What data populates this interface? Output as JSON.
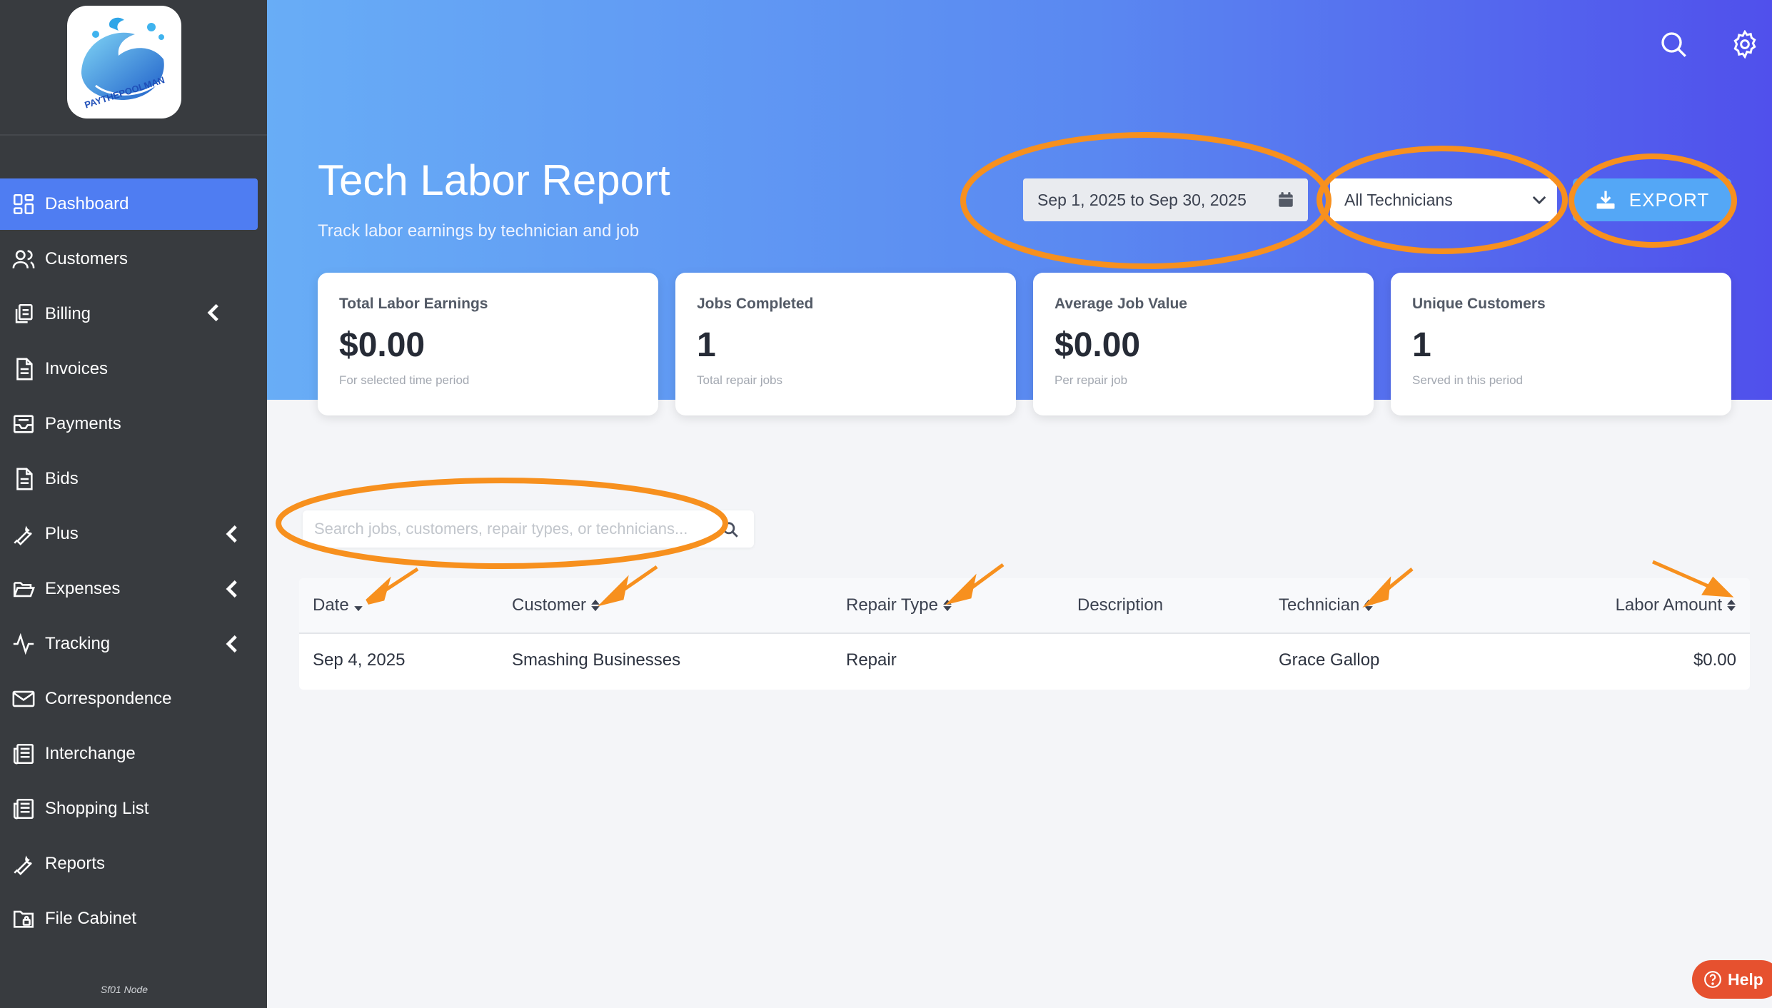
{
  "sidebar": {
    "logo_text": "PAYTHEPOOLMAN",
    "items": [
      {
        "label": "Dashboard",
        "icon": "dashboard-grid-icon",
        "active": true,
        "has_submenu": false
      },
      {
        "label": "Customers",
        "icon": "users-icon",
        "active": false,
        "has_submenu": false
      },
      {
        "label": "Billing",
        "icon": "billing-stack-icon",
        "active": false,
        "has_submenu": true
      },
      {
        "label": "Invoices",
        "icon": "document-icon",
        "active": false,
        "has_submenu": false
      },
      {
        "label": "Payments",
        "icon": "inbox-icon",
        "active": false,
        "has_submenu": false
      },
      {
        "label": "Bids",
        "icon": "document-icon",
        "active": false,
        "has_submenu": false
      },
      {
        "label": "Plus",
        "icon": "wrench-icon",
        "active": false,
        "has_submenu": true
      },
      {
        "label": "Expenses",
        "icon": "folder-open-icon",
        "active": false,
        "has_submenu": true
      },
      {
        "label": "Tracking",
        "icon": "activity-icon",
        "active": false,
        "has_submenu": true
      },
      {
        "label": "Correspondence",
        "icon": "mail-icon",
        "active": false,
        "has_submenu": false
      },
      {
        "label": "Interchange",
        "icon": "newspaper-icon",
        "active": false,
        "has_submenu": false
      },
      {
        "label": "Shopping List",
        "icon": "newspaper-icon",
        "active": false,
        "has_submenu": false
      },
      {
        "label": "Reports",
        "icon": "wrench-icon",
        "active": false,
        "has_submenu": false
      },
      {
        "label": "File Cabinet",
        "icon": "folder-lock-icon",
        "active": false,
        "has_submenu": false
      }
    ],
    "footer": "Sf01 Node"
  },
  "header": {
    "title": "Tech Labor Report",
    "subtitle": "Track labor earnings by technician and job",
    "date_range": "Sep 1, 2025 to Sep 30, 2025",
    "technician_filter": "All Technicians",
    "export_label": "EXPORT"
  },
  "cards": [
    {
      "label": "Total Labor Earnings",
      "value": "$0.00",
      "note": "For selected time period"
    },
    {
      "label": "Jobs Completed",
      "value": "1",
      "note": "Total repair jobs"
    },
    {
      "label": "Average Job Value",
      "value": "$0.00",
      "note": "Per repair job"
    },
    {
      "label": "Unique Customers",
      "value": "1",
      "note": "Served in this period"
    }
  ],
  "search": {
    "placeholder": "Search jobs, customers, repair types, or technicians..."
  },
  "table": {
    "columns": [
      "Date",
      "Customer",
      "Repair Type",
      "Description",
      "Technician",
      "Labor Amount"
    ],
    "rows": [
      {
        "date": "Sep 4, 2025",
        "customer": "Smashing Businesses",
        "repair_type": "Repair",
        "description": "",
        "technician": "Grace Gallop",
        "labor_amount": "$0.00"
      }
    ]
  },
  "help_label": "Help",
  "colors": {
    "sidebar_bg": "#383b3f",
    "active_nav": "#4f7df2",
    "gradient_start": "#68adf6",
    "gradient_end": "#5050ec",
    "export_btn": "#54a7f6",
    "annotation": "#f7901e",
    "help": "#e6512f"
  }
}
